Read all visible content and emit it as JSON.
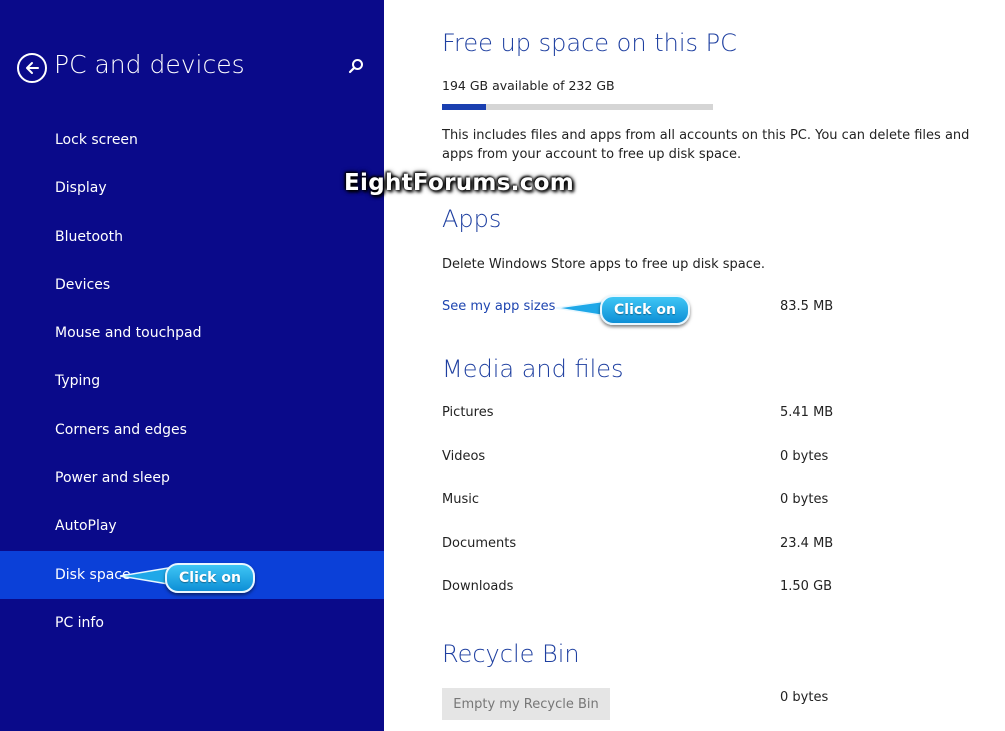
{
  "sidebar": {
    "title": "PC and devices",
    "items": [
      {
        "label": "Lock screen"
      },
      {
        "label": "Display"
      },
      {
        "label": "Bluetooth"
      },
      {
        "label": "Devices"
      },
      {
        "label": "Mouse and touchpad"
      },
      {
        "label": "Typing"
      },
      {
        "label": "Corners and edges"
      },
      {
        "label": "Power and sleep"
      },
      {
        "label": "AutoPlay"
      },
      {
        "label": "Disk space",
        "selected": true
      },
      {
        "label": "PC info"
      }
    ]
  },
  "callouts": {
    "disk_space": "Click on",
    "app_sizes": "Click on"
  },
  "watermark": "EightForums.com",
  "main": {
    "title": "Free up space on this PC",
    "available": "194 GB available of 232 GB",
    "used_fraction": 0.164,
    "description": "This includes files and apps from all accounts on this PC. You can delete files and apps from your account to free up disk space.",
    "apps": {
      "heading": "Apps",
      "description": "Delete Windows Store apps to free up disk space.",
      "link": "See my app sizes",
      "size": "83.5 MB"
    },
    "media": {
      "heading": "Media and files",
      "rows": [
        {
          "label": "Pictures",
          "value": "5.41 MB"
        },
        {
          "label": "Videos",
          "value": "0 bytes"
        },
        {
          "label": "Music",
          "value": "0 bytes"
        },
        {
          "label": "Documents",
          "value": "23.4 MB"
        },
        {
          "label": "Downloads",
          "value": "1.50 GB"
        }
      ]
    },
    "recycle": {
      "heading": "Recycle Bin",
      "button": "Empty my Recycle Bin",
      "value": "0 bytes"
    }
  },
  "colors": {
    "sidebar_bg": "#0a0a8a",
    "selected_bg": "#0b40d8",
    "heading": "#1e3fa0",
    "link": "#1e45b0",
    "callout": "#1fa8e8"
  }
}
